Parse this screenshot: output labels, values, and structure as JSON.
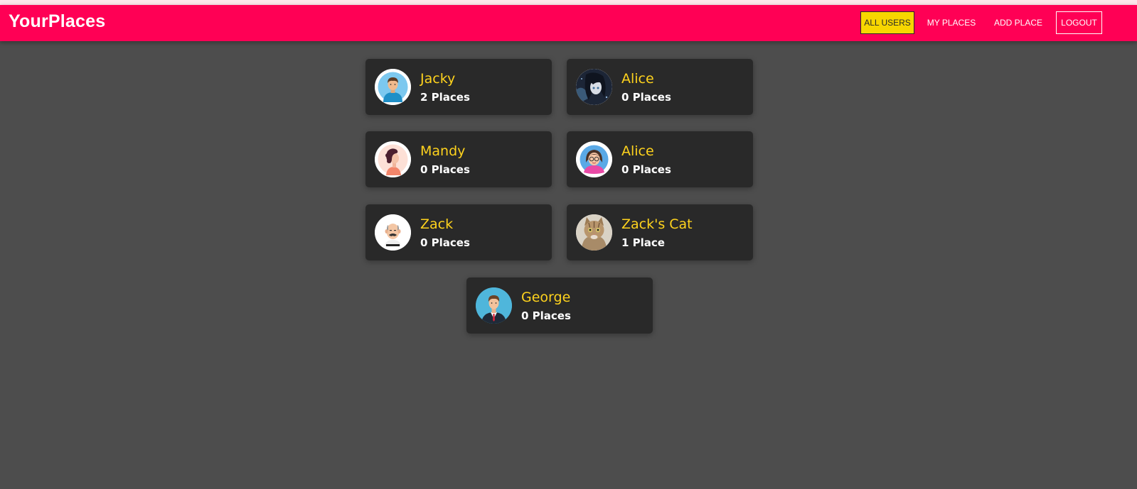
{
  "header": {
    "brand": "YourPlaces",
    "nav": [
      {
        "label": "ALL USERS",
        "active": true
      },
      {
        "label": "MY PLACES",
        "active": false
      },
      {
        "label": "ADD PLACE",
        "active": false
      },
      {
        "label": "LOGOUT",
        "active": false
      }
    ]
  },
  "colors": {
    "header_bg": "#ff0055",
    "page_bg": "#4d4d4d",
    "card_bg": "#292929",
    "name_color": "#ffd31d",
    "active_nav_bg": "#f7d600"
  },
  "users": [
    {
      "name": "Jacky",
      "places": "2 Places",
      "avatar": "man-blue-shirt-avatar"
    },
    {
      "name": "Alice",
      "places": "0 Places",
      "avatar": "anime-girl-avatar"
    },
    {
      "name": "Mandy",
      "places": "0 Places",
      "avatar": "woman-curly-hair-avatar"
    },
    {
      "name": "Alice",
      "places": "0 Places",
      "avatar": "woman-glasses-avatar"
    },
    {
      "name": "Zack",
      "places": "0 Places",
      "avatar": "bald-man-mustache-avatar"
    },
    {
      "name": "Zack's Cat",
      "places": "1 Place",
      "avatar": "cat-photo-avatar"
    },
    {
      "name": "George",
      "places": "0 Places",
      "avatar": "man-suit-avatar"
    }
  ]
}
